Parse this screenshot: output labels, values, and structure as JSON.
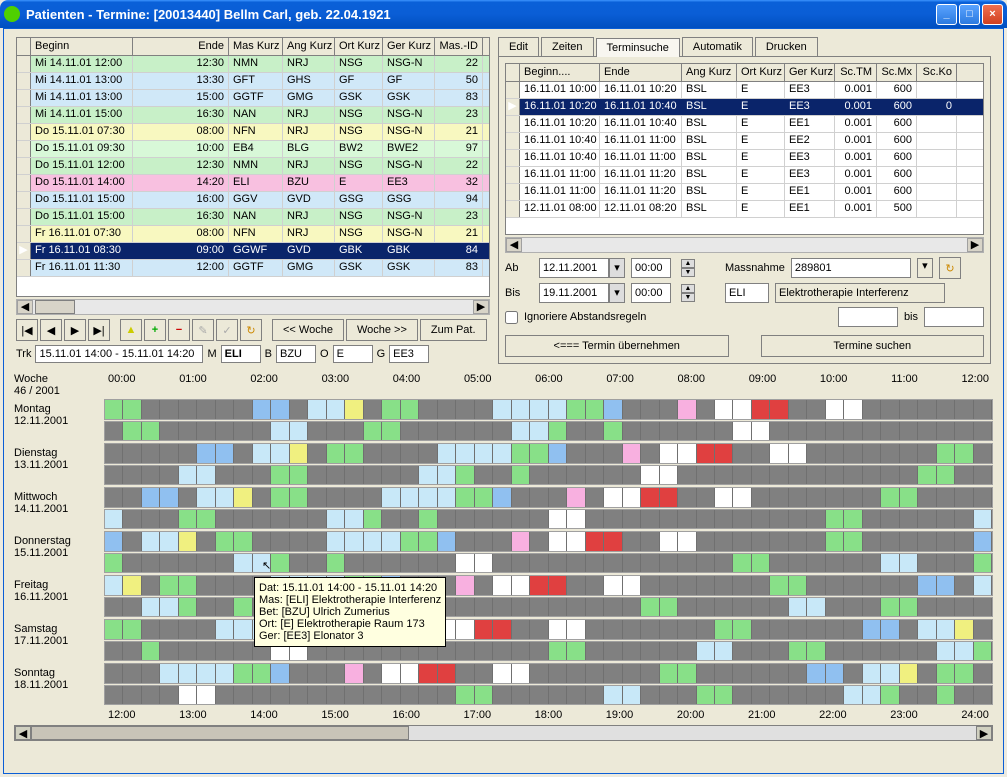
{
  "title": "Patienten - Termine: [20013440] Bellm Carl, geb. 22.04.1921",
  "left_grid": {
    "headers": [
      "Beginn",
      "Ende",
      "Mas Kurz",
      "Ang Kurz",
      "Ort Kurz",
      "Ger Kurz",
      "Mas.-ID"
    ],
    "rows": [
      {
        "bg": "bg-lgreen",
        "cells": [
          "Mi 14.11.01 12:00",
          "12:30",
          "NMN",
          "NRJ",
          "NSG",
          "NSG-N",
          "22"
        ]
      },
      {
        "bg": "bg-lblue",
        "cells": [
          "Mi 14.11.01 13:00",
          "13:30",
          "GFT",
          "GHS",
          "GF",
          "GF",
          "50"
        ]
      },
      {
        "bg": "bg-lblue",
        "cells": [
          "Mi 14.11.01 13:00",
          "15:00",
          "GGTF",
          "GMG",
          "GSK",
          "GSK",
          "83"
        ]
      },
      {
        "bg": "bg-lgreen",
        "cells": [
          "Mi 14.11.01 15:00",
          "16:30",
          "NAN",
          "NRJ",
          "NSG",
          "NSG-N",
          "23"
        ]
      },
      {
        "bg": "bg-yellow",
        "cells": [
          "Do 15.11.01 07:30",
          "08:00",
          "NFN",
          "NRJ",
          "NSG",
          "NSG-N",
          "21"
        ]
      },
      {
        "bg": "bg-green2",
        "cells": [
          "Do 15.11.01 09:30",
          "10:00",
          "EB4",
          "BLG",
          "BW2",
          "BWE2",
          "97"
        ]
      },
      {
        "bg": "bg-lgreen",
        "cells": [
          "Do 15.11.01 12:00",
          "12:30",
          "NMN",
          "NRJ",
          "NSG",
          "NSG-N",
          "22"
        ]
      },
      {
        "bg": "bg-pink",
        "cells": [
          "Do 15.11.01 14:00",
          "14:20",
          "ELI",
          "BZU",
          "E",
          "EE3",
          "32"
        ]
      },
      {
        "bg": "bg-lblue",
        "cells": [
          "Do 15.11.01 15:00",
          "16:00",
          "GGV",
          "GVD",
          "GSG",
          "GSG",
          "94"
        ]
      },
      {
        "bg": "bg-lgreen",
        "cells": [
          "Do 15.11.01 15:00",
          "16:30",
          "NAN",
          "NRJ",
          "NSG",
          "NSG-N",
          "23"
        ]
      },
      {
        "bg": "bg-yellow",
        "cells": [
          "Fr 16.11.01 07:30",
          "08:00",
          "NFN",
          "NRJ",
          "NSG",
          "NSG-N",
          "21"
        ]
      },
      {
        "bg": "",
        "selected": true,
        "cells": [
          "Fr 16.11.01 08:30",
          "09:00",
          "GGWF",
          "GVD",
          "GBK",
          "GBK",
          "84"
        ]
      },
      {
        "bg": "bg-lblue",
        "cells": [
          "Fr 16.11.01 11:30",
          "12:00",
          "GGTF",
          "GMG",
          "GSK",
          "GSK",
          "83"
        ]
      }
    ]
  },
  "toolbar": {
    "nav_first": "|◀",
    "nav_prev": "◀",
    "nav_next": "▶",
    "nav_last": "▶|",
    "woche_prev": "<<  Woche",
    "woche_next": "Woche  >>",
    "zum_pat": "Zum Pat."
  },
  "trk": {
    "label": "Trk",
    "range": "15.11.01 14:00 - 15.11.01 14:20",
    "M": "M",
    "M_val": "ELI",
    "B": "B",
    "B_val": "BZU",
    "O": "O",
    "O_val": "E",
    "G": "G",
    "G_val": "EE3"
  },
  "tabs": [
    "Edit",
    "Zeiten",
    "Terminsuche",
    "Automatik",
    "Drucken"
  ],
  "active_tab": "Terminsuche",
  "right_grid": {
    "headers": [
      "Beginn....",
      "Ende",
      "Ang Kurz",
      "Ort Kurz",
      "Ger Kurz",
      "Sc.TM",
      "Sc.Mx",
      "Sc.Ko"
    ],
    "rows": [
      {
        "cells": [
          "16.11.01 10:00",
          "16.11.01 10:20",
          "BSL",
          "E",
          "EE3",
          "0.001",
          "600",
          ""
        ]
      },
      {
        "selected": true,
        "cells": [
          "16.11.01 10:20",
          "16.11.01 10:40",
          "BSL",
          "E",
          "EE3",
          "0.001",
          "600",
          "0"
        ]
      },
      {
        "cells": [
          "16.11.01 10:20",
          "16.11.01 10:40",
          "BSL",
          "E",
          "EE1",
          "0.001",
          "600",
          ""
        ]
      },
      {
        "cells": [
          "16.11.01 10:40",
          "16.11.01 11:00",
          "BSL",
          "E",
          "EE2",
          "0.001",
          "600",
          ""
        ]
      },
      {
        "cells": [
          "16.11.01 10:40",
          "16.11.01 11:00",
          "BSL",
          "E",
          "EE3",
          "0.001",
          "600",
          ""
        ]
      },
      {
        "cells": [
          "16.11.01 11:00",
          "16.11.01 11:20",
          "BSL",
          "E",
          "EE3",
          "0.001",
          "600",
          ""
        ]
      },
      {
        "cells": [
          "16.11.01 11:00",
          "16.11.01 11:20",
          "BSL",
          "E",
          "EE1",
          "0.001",
          "600",
          ""
        ]
      },
      {
        "cells": [
          "12.11.01 08:00",
          "12.11.01 08:20",
          "BSL",
          "E",
          "EE1",
          "0.001",
          "500",
          ""
        ]
      }
    ]
  },
  "search": {
    "ab": "Ab",
    "ab_date": "12.11.2001",
    "ab_time": "00:00",
    "bis": "Bis",
    "bis_date": "19.11.2001",
    "bis_time": "00:00",
    "massnahme_lbl": "Massnahme",
    "massnahme": "289801",
    "eli": "ELI",
    "eli_desc": "Elektrotherapie Interferenz",
    "ignore": "Ignoriere Abstandsregeln",
    "bis2": "bis",
    "uebernehmen": "<===     Termin übernehmen",
    "suchen": "Termine suchen"
  },
  "timeline": {
    "week": "Woche\n46 / 2001",
    "hours_top": [
      "00:00",
      "01:00",
      "02:00",
      "03:00",
      "04:00",
      "05:00",
      "06:00",
      "07:00",
      "08:00",
      "09:00",
      "10:00",
      "11:00",
      "12:00"
    ],
    "hours_bot": [
      "12:00",
      "13:00",
      "14:00",
      "15:00",
      "16:00",
      "17:00",
      "18:00",
      "19:00",
      "20:00",
      "21:00",
      "22:00",
      "23:00",
      "24:00"
    ],
    "days": [
      {
        "name": "Montag",
        "date": "12.11.2001"
      },
      {
        "name": "Dienstag",
        "date": "13.11.2001"
      },
      {
        "name": "Mittwoch",
        "date": "14.11.2001"
      },
      {
        "name": "Donnerstag",
        "date": "15.11.2001"
      },
      {
        "name": "Freitag",
        "date": "16.11.2001"
      },
      {
        "name": "Samstag",
        "date": "17.11.2001"
      },
      {
        "name": "Sonntag",
        "date": "18.11.2001"
      }
    ]
  },
  "tooltip": "Dat: 15.11.01 14:00 - 15.11.01 14:20\nMas: [ELI] Elektrotherapie Interferenz\nBet: [BZU] Ulrich Zumerius\nOrt: [E] Elektrotherapie Raum 173\nGer: [EE3] Elonator 3"
}
